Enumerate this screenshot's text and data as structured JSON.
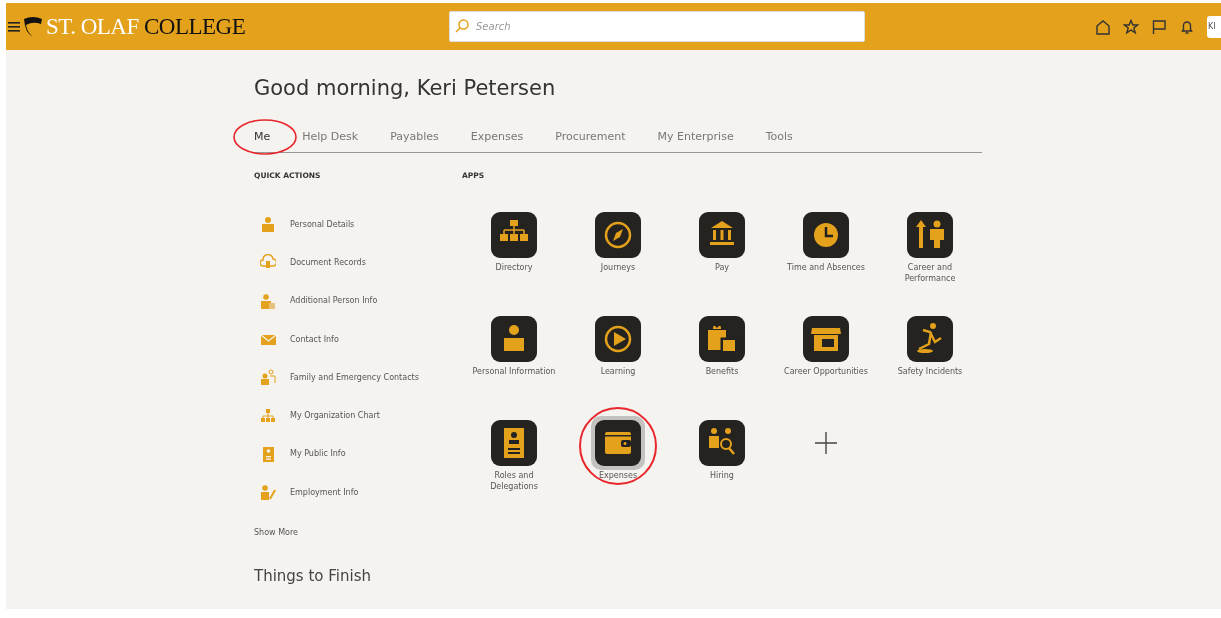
{
  "header": {
    "logo": {
      "part_1": "ST. OLAF",
      "part_2": "COLLEGE"
    },
    "search": {
      "placeholder": "Search"
    },
    "avatar": "KI"
  },
  "greeting": "Good morning, Keri Petersen",
  "tabs": [
    {
      "label": "Me",
      "selected": true,
      "annotated": true
    },
    {
      "label": "Help Desk",
      "selected": false,
      "annotated": false
    },
    {
      "label": "Payables",
      "selected": false,
      "annotated": false
    },
    {
      "label": "Expenses",
      "selected": false,
      "annotated": false
    },
    {
      "label": "Procurement",
      "selected": false,
      "annotated": false
    },
    {
      "label": "My Enterprise",
      "selected": false,
      "annotated": false
    },
    {
      "label": "Tools",
      "selected": false,
      "annotated": false
    }
  ],
  "quick_actions": {
    "heading": "QUICK ACTIONS",
    "items": [
      {
        "label": "Personal Details"
      },
      {
        "label": "Document Records"
      },
      {
        "label": "Additional Person Info"
      },
      {
        "label": "Contact Info"
      },
      {
        "label": "Family and Emergency Contacts"
      },
      {
        "label": "My Organization Chart"
      },
      {
        "label": "My Public Info"
      },
      {
        "label": "Employment Info"
      }
    ],
    "show_more": "Show More"
  },
  "apps": {
    "heading": "APPS",
    "items": [
      {
        "label": "Directory",
        "highlighted": false,
        "annotated": false
      },
      {
        "label": "Journeys",
        "highlighted": false,
        "annotated": false
      },
      {
        "label": "Pay",
        "highlighted": false,
        "annotated": false
      },
      {
        "label": "Time and Absences",
        "highlighted": false,
        "annotated": false
      },
      {
        "label": "Career and Performance",
        "highlighted": false,
        "annotated": false
      },
      {
        "label": "Personal Information",
        "highlighted": false,
        "annotated": false
      },
      {
        "label": "Learning",
        "highlighted": false,
        "annotated": false
      },
      {
        "label": "Benefits",
        "highlighted": false,
        "annotated": false
      },
      {
        "label": "Career Opportunities",
        "highlighted": false,
        "annotated": false
      },
      {
        "label": "Safety Incidents",
        "highlighted": false,
        "annotated": false
      },
      {
        "label": "Roles and Delegations",
        "highlighted": false,
        "annotated": false
      },
      {
        "label": "Expenses",
        "highlighted": true,
        "annotated": true
      },
      {
        "label": "Hiring",
        "highlighted": false,
        "annotated": false
      }
    ]
  },
  "things_to_finish": "Things to Finish"
}
